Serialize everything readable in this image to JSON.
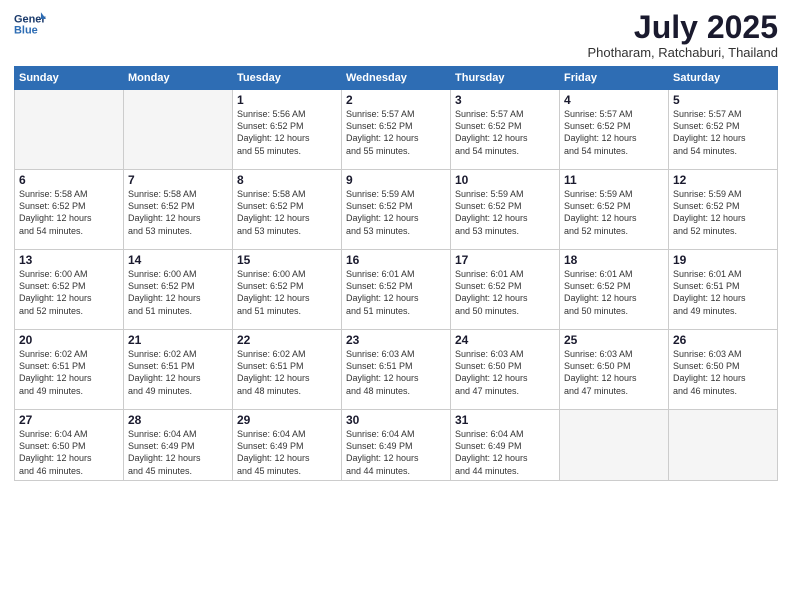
{
  "logo": {
    "line1": "General",
    "line2": "Blue"
  },
  "title": "July 2025",
  "subtitle": "Photharam, Ratchaburi, Thailand",
  "weekdays": [
    "Sunday",
    "Monday",
    "Tuesday",
    "Wednesday",
    "Thursday",
    "Friday",
    "Saturday"
  ],
  "weeks": [
    [
      {
        "day": "",
        "info": ""
      },
      {
        "day": "",
        "info": ""
      },
      {
        "day": "1",
        "info": "Sunrise: 5:56 AM\nSunset: 6:52 PM\nDaylight: 12 hours\nand 55 minutes."
      },
      {
        "day": "2",
        "info": "Sunrise: 5:57 AM\nSunset: 6:52 PM\nDaylight: 12 hours\nand 55 minutes."
      },
      {
        "day": "3",
        "info": "Sunrise: 5:57 AM\nSunset: 6:52 PM\nDaylight: 12 hours\nand 54 minutes."
      },
      {
        "day": "4",
        "info": "Sunrise: 5:57 AM\nSunset: 6:52 PM\nDaylight: 12 hours\nand 54 minutes."
      },
      {
        "day": "5",
        "info": "Sunrise: 5:57 AM\nSunset: 6:52 PM\nDaylight: 12 hours\nand 54 minutes."
      }
    ],
    [
      {
        "day": "6",
        "info": "Sunrise: 5:58 AM\nSunset: 6:52 PM\nDaylight: 12 hours\nand 54 minutes."
      },
      {
        "day": "7",
        "info": "Sunrise: 5:58 AM\nSunset: 6:52 PM\nDaylight: 12 hours\nand 53 minutes."
      },
      {
        "day": "8",
        "info": "Sunrise: 5:58 AM\nSunset: 6:52 PM\nDaylight: 12 hours\nand 53 minutes."
      },
      {
        "day": "9",
        "info": "Sunrise: 5:59 AM\nSunset: 6:52 PM\nDaylight: 12 hours\nand 53 minutes."
      },
      {
        "day": "10",
        "info": "Sunrise: 5:59 AM\nSunset: 6:52 PM\nDaylight: 12 hours\nand 53 minutes."
      },
      {
        "day": "11",
        "info": "Sunrise: 5:59 AM\nSunset: 6:52 PM\nDaylight: 12 hours\nand 52 minutes."
      },
      {
        "day": "12",
        "info": "Sunrise: 5:59 AM\nSunset: 6:52 PM\nDaylight: 12 hours\nand 52 minutes."
      }
    ],
    [
      {
        "day": "13",
        "info": "Sunrise: 6:00 AM\nSunset: 6:52 PM\nDaylight: 12 hours\nand 52 minutes."
      },
      {
        "day": "14",
        "info": "Sunrise: 6:00 AM\nSunset: 6:52 PM\nDaylight: 12 hours\nand 51 minutes."
      },
      {
        "day": "15",
        "info": "Sunrise: 6:00 AM\nSunset: 6:52 PM\nDaylight: 12 hours\nand 51 minutes."
      },
      {
        "day": "16",
        "info": "Sunrise: 6:01 AM\nSunset: 6:52 PM\nDaylight: 12 hours\nand 51 minutes."
      },
      {
        "day": "17",
        "info": "Sunrise: 6:01 AM\nSunset: 6:52 PM\nDaylight: 12 hours\nand 50 minutes."
      },
      {
        "day": "18",
        "info": "Sunrise: 6:01 AM\nSunset: 6:52 PM\nDaylight: 12 hours\nand 50 minutes."
      },
      {
        "day": "19",
        "info": "Sunrise: 6:01 AM\nSunset: 6:51 PM\nDaylight: 12 hours\nand 49 minutes."
      }
    ],
    [
      {
        "day": "20",
        "info": "Sunrise: 6:02 AM\nSunset: 6:51 PM\nDaylight: 12 hours\nand 49 minutes."
      },
      {
        "day": "21",
        "info": "Sunrise: 6:02 AM\nSunset: 6:51 PM\nDaylight: 12 hours\nand 49 minutes."
      },
      {
        "day": "22",
        "info": "Sunrise: 6:02 AM\nSunset: 6:51 PM\nDaylight: 12 hours\nand 48 minutes."
      },
      {
        "day": "23",
        "info": "Sunrise: 6:03 AM\nSunset: 6:51 PM\nDaylight: 12 hours\nand 48 minutes."
      },
      {
        "day": "24",
        "info": "Sunrise: 6:03 AM\nSunset: 6:50 PM\nDaylight: 12 hours\nand 47 minutes."
      },
      {
        "day": "25",
        "info": "Sunrise: 6:03 AM\nSunset: 6:50 PM\nDaylight: 12 hours\nand 47 minutes."
      },
      {
        "day": "26",
        "info": "Sunrise: 6:03 AM\nSunset: 6:50 PM\nDaylight: 12 hours\nand 46 minutes."
      }
    ],
    [
      {
        "day": "27",
        "info": "Sunrise: 6:04 AM\nSunset: 6:50 PM\nDaylight: 12 hours\nand 46 minutes."
      },
      {
        "day": "28",
        "info": "Sunrise: 6:04 AM\nSunset: 6:49 PM\nDaylight: 12 hours\nand 45 minutes."
      },
      {
        "day": "29",
        "info": "Sunrise: 6:04 AM\nSunset: 6:49 PM\nDaylight: 12 hours\nand 45 minutes."
      },
      {
        "day": "30",
        "info": "Sunrise: 6:04 AM\nSunset: 6:49 PM\nDaylight: 12 hours\nand 44 minutes."
      },
      {
        "day": "31",
        "info": "Sunrise: 6:04 AM\nSunset: 6:49 PM\nDaylight: 12 hours\nand 44 minutes."
      },
      {
        "day": "",
        "info": ""
      },
      {
        "day": "",
        "info": ""
      }
    ]
  ]
}
